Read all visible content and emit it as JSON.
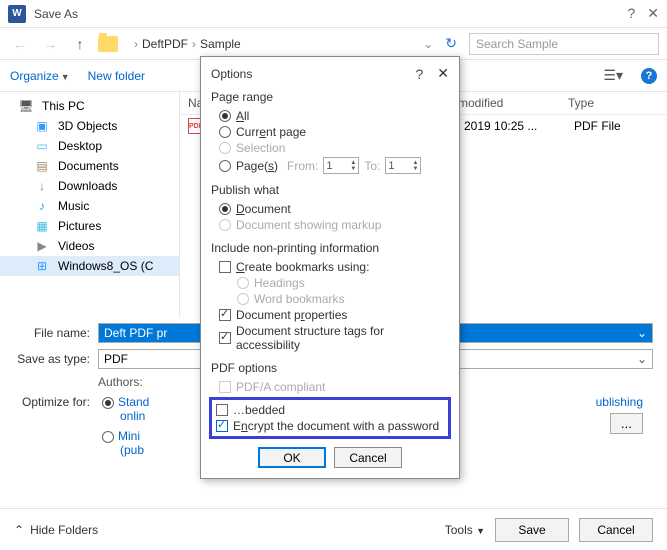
{
  "titlebar": {
    "title": "Save As"
  },
  "nav": {
    "crumb1": "DeftPDF",
    "crumb2": "Sample",
    "search_placeholder": "Search Sample"
  },
  "toolbar": {
    "organize": "Organize",
    "newfolder": "New folder"
  },
  "sidebar": {
    "items": [
      {
        "label": "This PC"
      },
      {
        "label": "3D Objects"
      },
      {
        "label": "Desktop"
      },
      {
        "label": "Documents"
      },
      {
        "label": "Downloads"
      },
      {
        "label": "Music"
      },
      {
        "label": "Pictures"
      },
      {
        "label": "Videos"
      },
      {
        "label": "Windows8_OS (C"
      }
    ]
  },
  "filelist": {
    "headers": {
      "name": "Na",
      "modified": "modified",
      "type": "Type"
    },
    "row": {
      "name_fragment": "",
      "modified": "2019 10:25 ...",
      "type": "PDF File"
    }
  },
  "form": {
    "filename_label": "File name:",
    "filename_value": "Deft PDF pr",
    "saveastype_label": "Save as type:",
    "saveastype_value": "PDF",
    "authors_label": "Authors:",
    "optimize_label": "Optimize for:",
    "opt_standard": "Stand",
    "opt_online": "onlin",
    "opt_min": "Mini",
    "opt_pub": "(pub",
    "opt_publish_link": "ublishing",
    "options_btn": "..."
  },
  "footer": {
    "hide_folders": "Hide Folders",
    "tools": "Tools",
    "save": "Save",
    "cancel": "Cancel"
  },
  "modal": {
    "title": "Options",
    "page_range": {
      "header": "Page range",
      "all": "All",
      "current": "Current page",
      "selection": "Selection",
      "pages": "Page(s)",
      "from": "From:",
      "to": "To:",
      "from_val": "1",
      "to_val": "1"
    },
    "publish": {
      "header": "Publish what",
      "document": "Document",
      "markup": "Document showing markup"
    },
    "nonprint": {
      "header": "Include non-printing information",
      "bookmarks": "Create bookmarks using:",
      "headings": "Headings",
      "wordbm": "Word bookmarks",
      "docprops": "Document properties",
      "structtags": "Document structure tags for accessibility"
    },
    "pdfopts": {
      "header": "PDF options",
      "pdfa": "PDF/A compliant",
      "bitmap_frag": "bedded",
      "encrypt": "Encrypt the document with a password"
    },
    "ok": "OK",
    "cancel": "Cancel"
  }
}
